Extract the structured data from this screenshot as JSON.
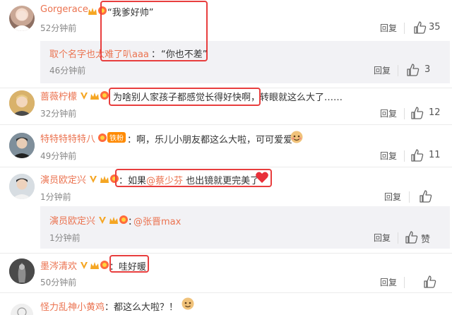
{
  "comments": [
    {
      "user": "Gorgerace",
      "text": "“我爹好帅”",
      "time": "52分钟前",
      "reply_label": "回复",
      "likes": "35",
      "sub": {
        "user": "取个名字也太难了叭aaa",
        "colon": "：",
        "text": "“你也不差”",
        "time": "46分钟前",
        "reply_label": "回复",
        "likes": "3"
      }
    },
    {
      "user": "蔷薇柠檬",
      "text": "为啥别人家孩子都感觉长得好快啊，转眼就这么大了……",
      "time": "32分钟前",
      "reply_label": "回复",
      "likes": "12"
    },
    {
      "user": "特特特特特八",
      "fan_badge": "铁粉",
      "text": "：啊，乐儿小朋友都这么大啦，可可爱爱",
      "time": "49分钟前",
      "reply_label": "回复",
      "likes": "11"
    },
    {
      "user": "演员欧定兴",
      "text_prefix": "：如果",
      "mention": "@蔡少芬",
      "text_suffix": " 也出镜就更完美了",
      "time": "1分钟前",
      "reply_label": "回复",
      "likes": "",
      "sub": {
        "user": "演员欧定兴",
        "colon": "：",
        "mention": "@张晋max",
        "time": "1分钟前",
        "reply_label": "回复",
        "likes": "赞"
      }
    },
    {
      "user": "墨涔清欢",
      "text": "：哇好暖",
      "time": "50分钟前",
      "reply_label": "回复",
      "likes": ""
    },
    {
      "user": "怪力乱神小黄鸡",
      "text": "：都这么大啦？！"
    }
  ],
  "colors": {
    "username": "#eb7350",
    "highlight": "#e83e3e",
    "reply_bg": "#f2f2f5"
  }
}
